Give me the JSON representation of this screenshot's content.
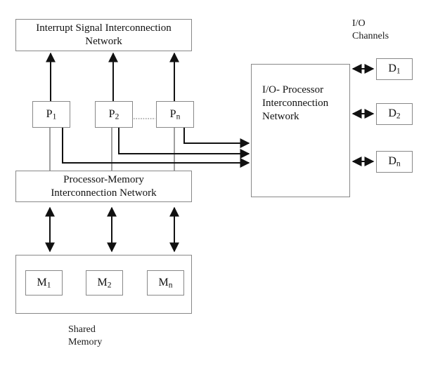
{
  "diagram": {
    "title_hidden": "Multiprocessor interconnection block diagram",
    "colors": {
      "box_border": "#888888",
      "wire_dark": "#111111",
      "wire_light": "#999999",
      "background": "#ffffff",
      "text": "#1a1a1a"
    },
    "boxes": {
      "interrupt_network": {
        "line1": "Interrupt Signal Interconnection",
        "line2": "Network"
      },
      "io_processor_network": {
        "line1": "I/O- Processor",
        "line2": "Interconnection",
        "line3": "Network"
      },
      "processor_memory_network": {
        "line1": "Processor-Memory",
        "line2": "Interconnection Network"
      }
    },
    "processors": [
      {
        "base": "P",
        "sub": "1"
      },
      {
        "base": "P",
        "sub": "2"
      },
      {
        "base": "P",
        "sub": "n"
      }
    ],
    "memories": [
      {
        "base": "M",
        "sub": "1"
      },
      {
        "base": "M",
        "sub": "2"
      },
      {
        "base": "M",
        "sub": "n"
      }
    ],
    "devices": [
      {
        "base": "D",
        "sub": "1"
      },
      {
        "base": "D",
        "sub": "2"
      },
      {
        "base": "D",
        "sub": "n"
      }
    ],
    "labels": {
      "io_channels": "I/O\nChannels",
      "shared_memory": "Shared\nMemory"
    },
    "connections": {
      "interrupt_arrows": "3 upward arrows from processors to interrupt signal interconnection network",
      "io_arrows": "3 rightward arrows from processors to I/O-processor interconnection network",
      "memory_arrows": "3 bidirectional vertical arrows between processor-memory network and shared memory",
      "processor_chain": "dotted line between P2 and Pn indicating continuation",
      "device_arrows": "3 bidirectional arrows between I/O-processor network and I/O channel devices"
    }
  }
}
